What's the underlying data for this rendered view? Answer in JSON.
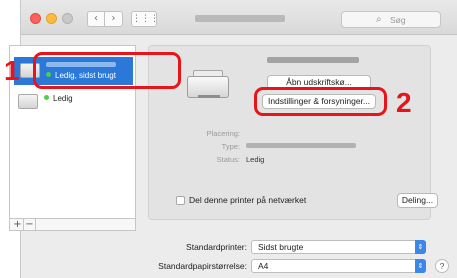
{
  "toolbar": {
    "back_glyph": "‹",
    "forward_glyph": "›",
    "grid_glyph": "⋮⋮⋮",
    "search_placeholder": "Søg",
    "search_icon": "magnifier-icon"
  },
  "printer_list": {
    "items": [
      {
        "status": "Ledig, sidst brugt",
        "selected": true,
        "status_color": "#4bd04b"
      },
      {
        "status": "Ledig",
        "selected": false,
        "status_color": "#4bd04b"
      }
    ],
    "add_label": "+",
    "remove_label": "−"
  },
  "detail": {
    "open_queue_label": "Åbn udskriftskø...",
    "options_label": "Indstillinger & forsyninger...",
    "location_label": "Placering:",
    "type_label": "Type:",
    "status_label": "Status:",
    "status_value": "Ledig",
    "share_label": "Del denne printer på netværket",
    "share_checked": false,
    "sharing_button_label": "Deling..."
  },
  "defaults": {
    "default_printer_label": "Standardprinter:",
    "default_printer_value": "Sidst brugte",
    "default_paper_label": "Standardpapirstørrelse:",
    "default_paper_value": "A4",
    "help_label": "?"
  },
  "callouts": {
    "one": "1",
    "two": "2",
    "color": "#e8141b"
  }
}
